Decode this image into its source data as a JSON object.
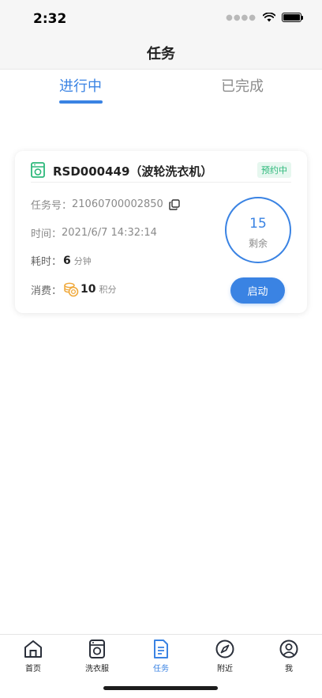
{
  "status_bar": {
    "time": "2:32"
  },
  "header": {
    "title": "任务"
  },
  "tabs": [
    {
      "label": "进行中",
      "active": true
    },
    {
      "label": "已完成",
      "active": false
    }
  ],
  "task": {
    "title": "RSD000449（波轮洗衣机）",
    "badge": "预约中",
    "task_no_label": "任务号：",
    "task_no": "21060700002850",
    "time_label": "时间：",
    "time": "2021/6/7 14:32:14",
    "duration_label": "耗时：",
    "duration_value": "6",
    "duration_unit": "分钟",
    "cost_label": "消费：",
    "cost_value": "10",
    "cost_unit": "积分",
    "remaining_value": "15",
    "remaining_label": "剩余",
    "start_label": "启动"
  },
  "tab_bar": [
    {
      "label": "首页",
      "icon": "home-icon"
    },
    {
      "label": "洗衣服",
      "icon": "washer-icon"
    },
    {
      "label": "任务",
      "icon": "document-icon",
      "active": true
    },
    {
      "label": "附近",
      "icon": "compass-icon"
    },
    {
      "label": "我",
      "icon": "user-icon"
    }
  ],
  "colors": {
    "accent": "#3a83e3",
    "badge_green": "#2cb87a",
    "coin": "#f0a93b"
  }
}
